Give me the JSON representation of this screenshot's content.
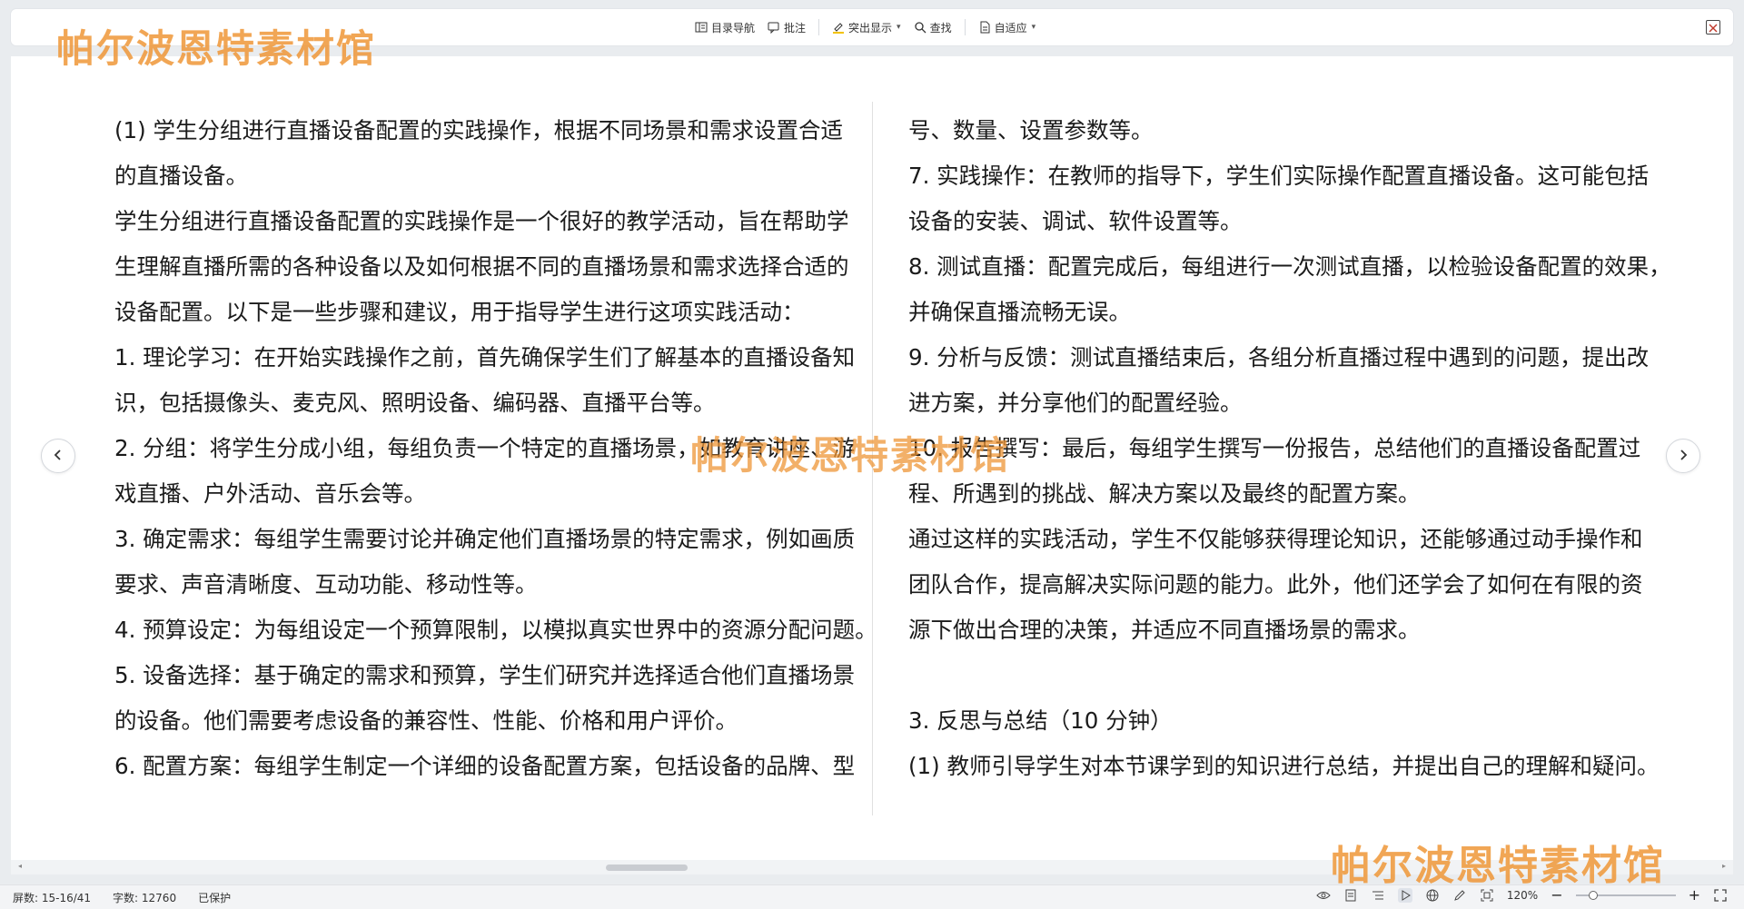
{
  "toolbar": {
    "items": [
      {
        "label": "目录导航",
        "icon": "outline-icon"
      },
      {
        "label": "批注",
        "icon": "comment-icon"
      },
      {
        "label": "突出显示",
        "icon": "highlight-icon",
        "dropdown": true
      },
      {
        "label": "查找",
        "icon": "search-icon"
      },
      {
        "label": "自适应",
        "icon": "page-fit-icon",
        "dropdown": true
      }
    ]
  },
  "document": {
    "left_column": [
      "(1) 学生分组进行直播设备配置的实践操作，根据不同场景和需求设置合适",
      "的直播设备。",
      "学生分组进行直播设备配置的实践操作是一个很好的教学活动，旨在帮助学",
      "生理解直播所需的各种设备以及如何根据不同的直播场景和需求选择合适的",
      "设备配置。以下是一些步骤和建议，用于指导学生进行这项实践活动：",
      "1. 理论学习：在开始实践操作之前，首先确保学生们了解基本的直播设备知",
      "识，包括摄像头、麦克风、照明设备、编码器、直播平台等。",
      "2. 分组：将学生分成小组，每组负责一个特定的直播场景，如教育讲座、游",
      "戏直播、户外活动、音乐会等。",
      "3. 确定需求：每组学生需要讨论并确定他们直播场景的特定需求，例如画质",
      "要求、声音清晰度、互动功能、移动性等。",
      "4. 预算设定：为每组设定一个预算限制，以模拟真实世界中的资源分配问题。",
      "5. 设备选择：基于确定的需求和预算，学生们研究并选择适合他们直播场景",
      "的设备。他们需要考虑设备的兼容性、性能、价格和用户评价。",
      "6. 配置方案：每组学生制定一个详细的设备配置方案，包括设备的品牌、型"
    ],
    "right_column": [
      "号、数量、设置参数等。",
      "7. 实践操作：在教师的指导下，学生们实际操作配置直播设备。这可能包括",
      "设备的安装、调试、软件设置等。",
      "8. 测试直播：配置完成后，每组进行一次测试直播，以检验设备配置的效果，",
      "并确保直播流畅无误。",
      "9. 分析与反馈：测试直播结束后，各组分析直播过程中遇到的问题，提出改",
      "进方案，并分享他们的配置经验。",
      "10. 报告撰写：最后，每组学生撰写一份报告，总结他们的直播设备配置过",
      "程、所遇到的挑战、解决方案以及最终的配置方案。",
      "通过这样的实践活动，学生不仅能够获得理论知识，还能够通过动手操作和",
      "团队合作，提高解决实际问题的能力。此外，他们还学会了如何在有限的资",
      "源下做出合理的决策，并适应不同直播场景的需求。",
      "",
      "3. 反思与总结（10 分钟）",
      "(1) 教师引导学生对本节课学到的知识进行总结，并提出自己的理解和疑问。"
    ]
  },
  "watermark": "帕尔波恩特素材馆",
  "status": {
    "page": "屏数: 15-16/41",
    "word_count": "字数: 12760",
    "protection": "已保护",
    "zoom": "120%",
    "zoom_fraction": 0.14
  },
  "colors": {
    "watermark": "#EE9637",
    "background": "#E9ECEF"
  }
}
